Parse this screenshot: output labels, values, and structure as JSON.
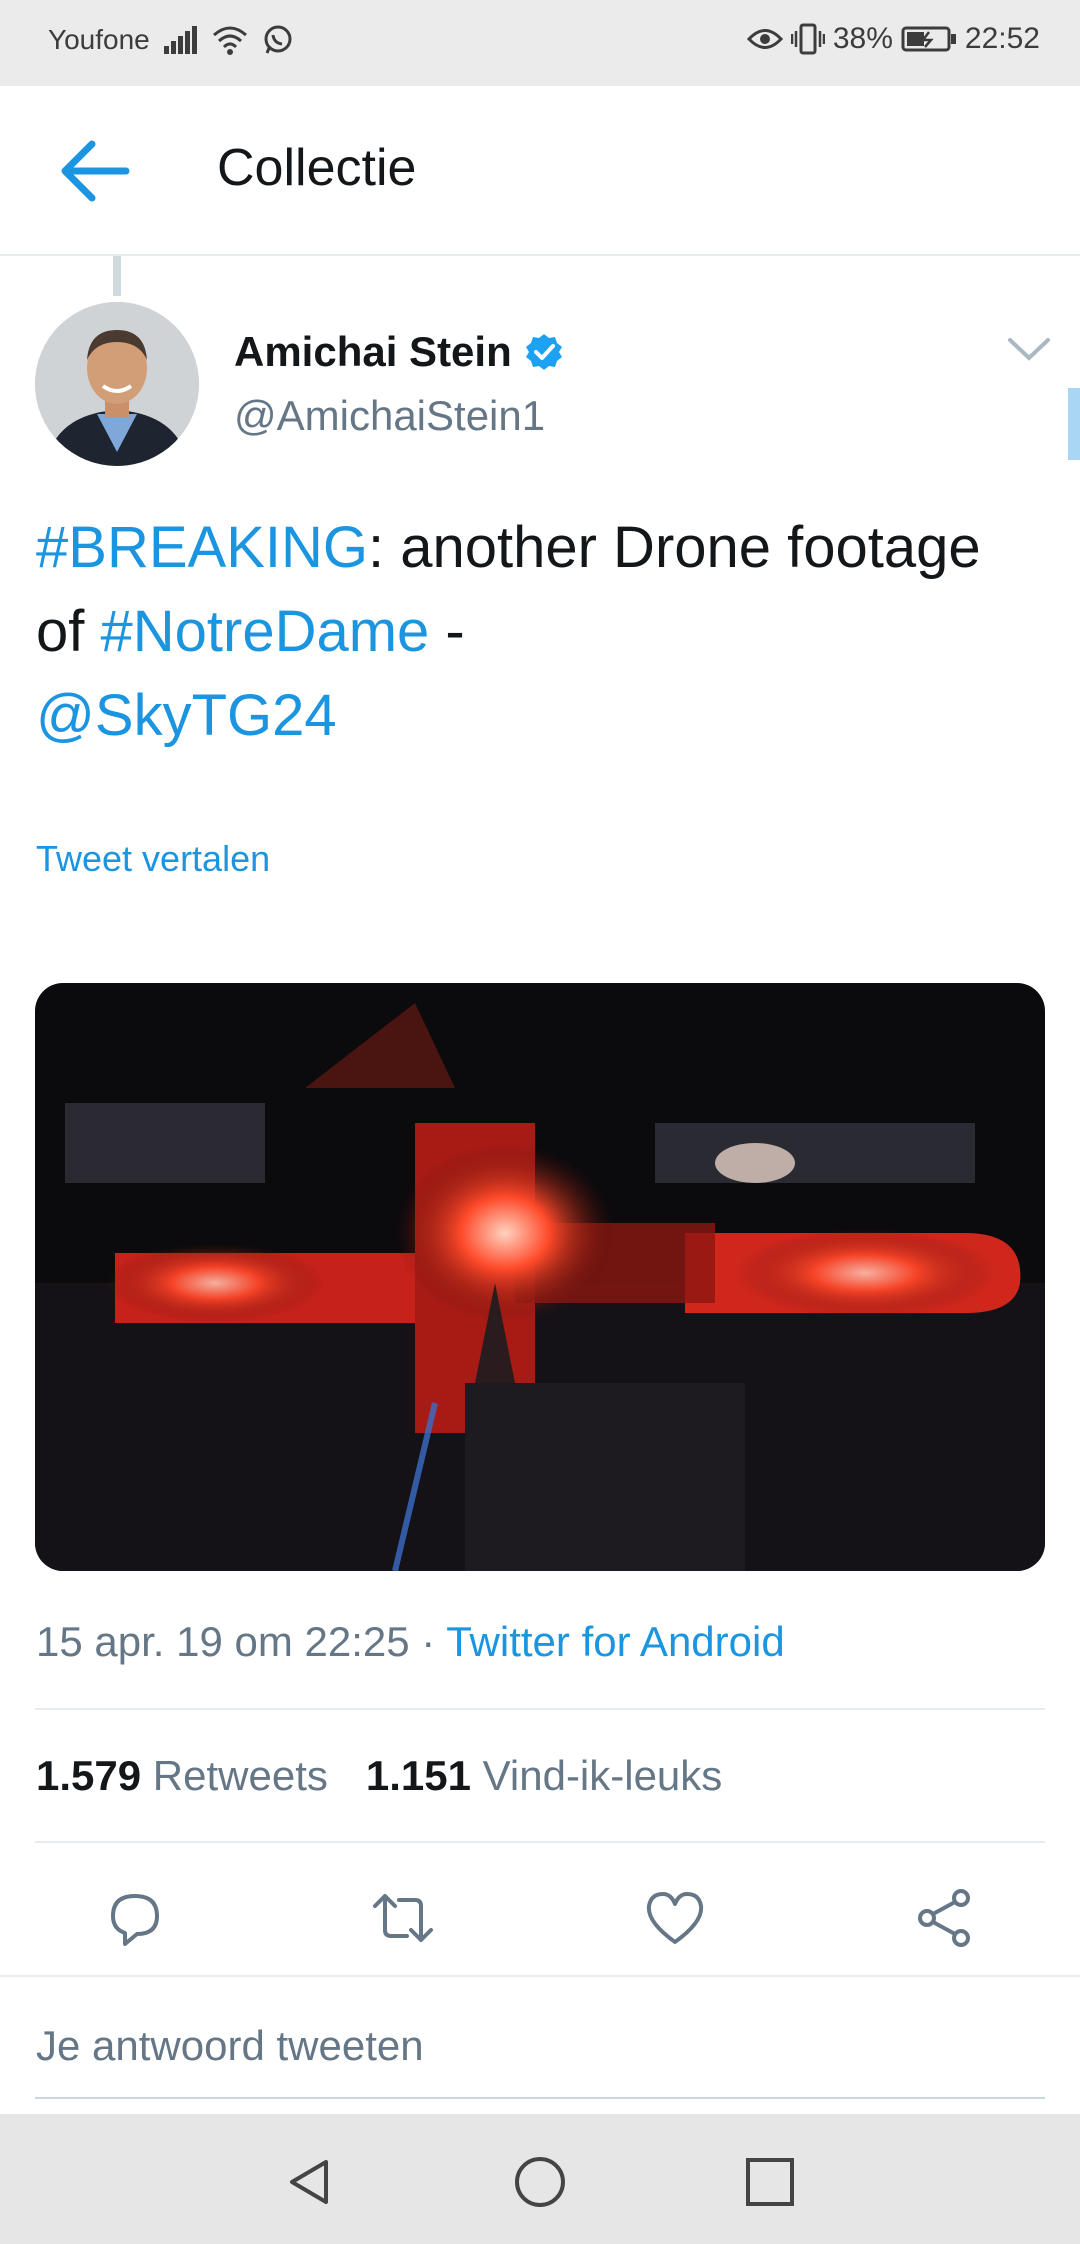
{
  "status_bar": {
    "carrier": "Youfone",
    "battery": "38%",
    "time": "22:52"
  },
  "header": {
    "title": "Collectie"
  },
  "tweet": {
    "author_name": "Amichai Stein",
    "author_handle": "@AmichaiStein1",
    "text": {
      "hashtag1": "#BREAKING",
      "part1": ": another Drone footage of ",
      "hashtag2": "#NotreDame",
      "part2": " - ",
      "mention": "@SkyTG24"
    },
    "translate_label": "Tweet vertalen",
    "timestamp": "15 apr. 19 om 22:25",
    "separator": "·",
    "source": "Twitter for Android",
    "retweets_count": "1.579",
    "retweets_label": "Retweets",
    "likes_count": "1.151",
    "likes_label": "Vind-ik-leuks"
  },
  "reply": {
    "placeholder": "Je antwoord tweeten"
  },
  "colors": {
    "accent": "#1b95e0",
    "secondary_text": "#657786",
    "primary_text": "#14171a"
  },
  "icons": [
    "back-arrow-icon",
    "verified-badge-icon",
    "chevron-down-icon",
    "reply-icon",
    "retweet-icon",
    "like-icon",
    "share-icon",
    "nav-back-icon",
    "nav-home-icon",
    "nav-recents-icon"
  ]
}
